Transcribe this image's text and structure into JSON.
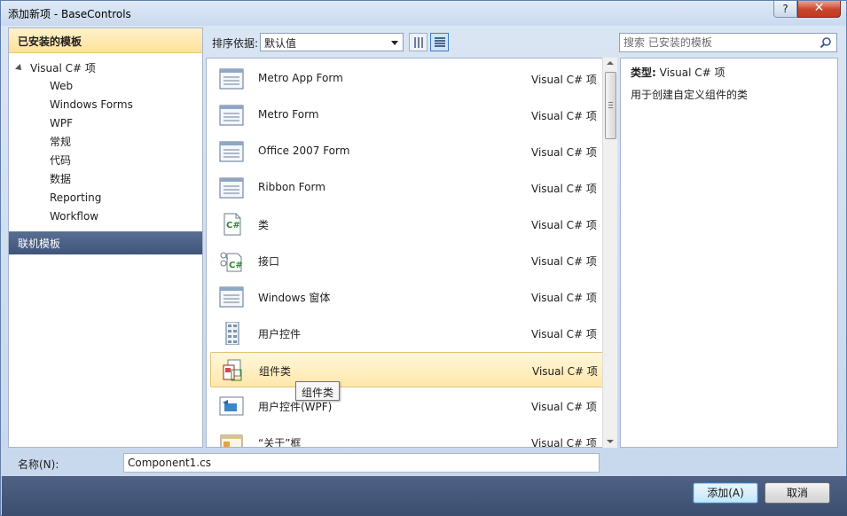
{
  "window": {
    "title": "添加新项 - BaseControls",
    "help_label": "?",
    "close_label": "✕"
  },
  "left_panel": {
    "installed_header": "已安装的模板",
    "root_label": "Visual C# 项",
    "items": [
      "Web",
      "Windows Forms",
      "WPF",
      "常规",
      "代码",
      "数据",
      "Reporting",
      "Workflow"
    ],
    "online_header": "联机模板"
  },
  "toolbar": {
    "sort_label": "排序依据:",
    "sort_value": "默认值"
  },
  "search": {
    "placeholder": "搜索 已安装的模板"
  },
  "templates": [
    {
      "name": "Metro App Form",
      "type": "Visual C# 项",
      "icon": "form-icon"
    },
    {
      "name": "Metro Form",
      "type": "Visual C# 项",
      "icon": "form-icon"
    },
    {
      "name": "Office 2007 Form",
      "type": "Visual C# 项",
      "icon": "form-icon"
    },
    {
      "name": "Ribbon Form",
      "type": "Visual C# 项",
      "icon": "form-icon"
    },
    {
      "name": "类",
      "type": "Visual C# 项",
      "icon": "csharp-class-icon"
    },
    {
      "name": "接口",
      "type": "Visual C# 项",
      "icon": "csharp-interface-icon"
    },
    {
      "name": "Windows 窗体",
      "type": "Visual C# 项",
      "icon": "form-icon"
    },
    {
      "name": "用户控件",
      "type": "Visual C# 项",
      "icon": "user-control-icon"
    },
    {
      "name": "组件类",
      "type": "Visual C# 项",
      "icon": "component-class-icon",
      "selected": true
    },
    {
      "name": "用户控件(WPF)",
      "type": "Visual C# 项",
      "icon": "wpf-user-control-icon"
    },
    {
      "name": "“关于”框",
      "type": "Visual C# 项",
      "icon": "about-box-icon"
    }
  ],
  "tooltip": "组件类",
  "details": {
    "type_label": "类型:",
    "type_value": "Visual C# 项",
    "description": "用于创建自定义组件的类"
  },
  "name_field": {
    "label": "名称(N):",
    "value": "Component1.cs"
  },
  "buttons": {
    "add_label": "添加(A)",
    "cancel_label": "取消"
  },
  "colors": {
    "header_gold": "#ffe09a",
    "navy_bar": "#3f5479",
    "selection": "#ffe7a9"
  }
}
